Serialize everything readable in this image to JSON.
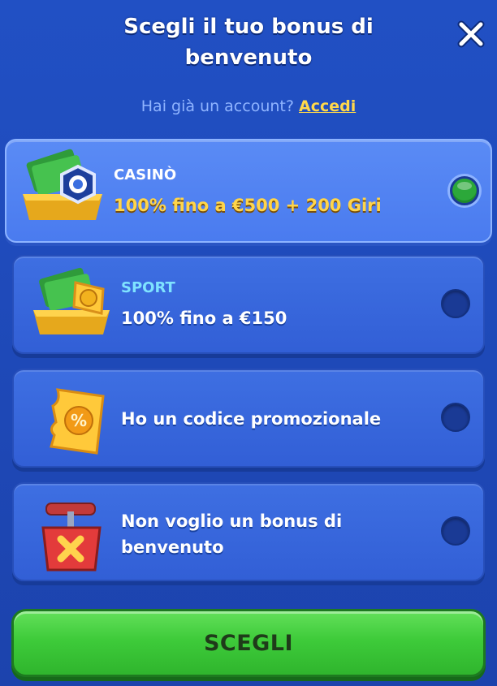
{
  "header": {
    "title": "Scegli il tuo bonus di benvenuto",
    "close_icon": "close-icon"
  },
  "login": {
    "prompt": "Hai già un account?",
    "link_label": "Accedi"
  },
  "options": [
    {
      "category": "CASINÒ",
      "text": "100% fino a €500 + 200 Giri",
      "selected": true,
      "icon": "casino-cash-chest-icon"
    },
    {
      "category": "SPORT",
      "text": "100% fino a €150",
      "selected": false,
      "icon": "sport-cash-chest-icon"
    },
    {
      "category": "",
      "text": "Ho un codice promozionale",
      "selected": false,
      "icon": "promo-code-ticket-icon"
    },
    {
      "category": "",
      "text": "Non voglio un bonus di benvenuto",
      "selected": false,
      "icon": "no-bonus-detonator-icon"
    }
  ],
  "cta": {
    "label": "SCEGLI"
  },
  "colors": {
    "background": "#1f47b8",
    "casino_label": "#ffffff",
    "sport_label": "#7fe3ff",
    "bonus_gold": "#ffd54a",
    "selected_radio": "#2ca83a",
    "cta_green": "#3ecb3a"
  }
}
